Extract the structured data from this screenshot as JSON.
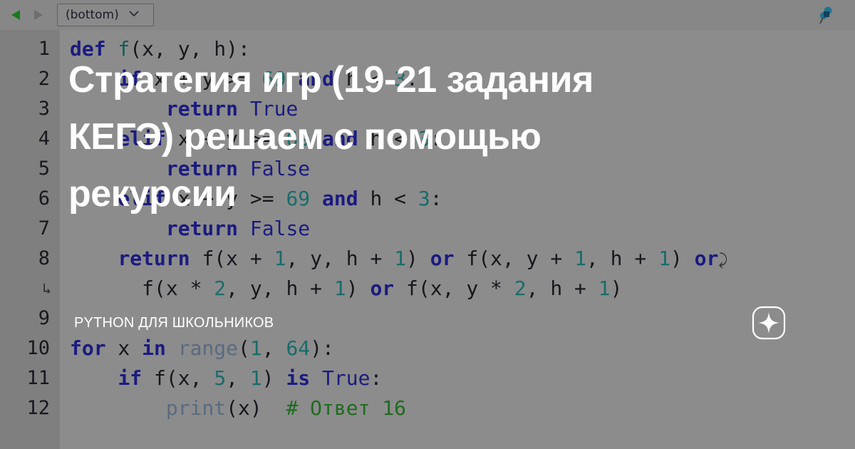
{
  "toolbar": {
    "back_icon": "triangle-left-icon",
    "forward_icon": "triangle-right-icon",
    "bookmark_value": "(bottom)",
    "chevron_icon": "chevron-down-icon",
    "pin_icon": "pushpin-icon"
  },
  "editor": {
    "line_numbers": [
      "1",
      "2",
      "3",
      "4",
      "5",
      "6",
      "7",
      "8",
      "",
      "9",
      "10",
      "11",
      "12"
    ],
    "wrap_marker": "↳",
    "lines": [
      {
        "n": "1",
        "tokens": [
          {
            "t": "def ",
            "c": "kw"
          },
          {
            "t": "f",
            "c": "fn"
          },
          {
            "t": "(x, y, h):",
            "c": "pn"
          }
        ]
      },
      {
        "n": "2",
        "tokens": [
          {
            "t": "    ",
            "c": "pn"
          },
          {
            "t": "if",
            "c": "kw"
          },
          {
            "t": " x + y >= ",
            "c": "pn"
          },
          {
            "t": "69",
            "c": "num"
          },
          {
            "t": " ",
            "c": "pn"
          },
          {
            "t": "and",
            "c": "kw"
          },
          {
            "t": " h < ",
            "c": "pn"
          },
          {
            "t": "3",
            "c": "num"
          },
          {
            "t": ":",
            "c": "pn"
          }
        ]
      },
      {
        "n": "3",
        "tokens": [
          {
            "t": "        ",
            "c": "pn"
          },
          {
            "t": "return",
            "c": "kw"
          },
          {
            "t": " ",
            "c": "pn"
          },
          {
            "t": "True",
            "c": "kw2"
          }
        ]
      },
      {
        "n": "4",
        "tokens": [
          {
            "t": "    ",
            "c": "pn"
          },
          {
            "t": "elif",
            "c": "kw"
          },
          {
            "t": " x + y >= ",
            "c": "pn"
          },
          {
            "t": "69",
            "c": "num"
          },
          {
            "t": " ",
            "c": "pn"
          },
          {
            "t": "and",
            "c": "kw"
          },
          {
            "t": " h < ",
            "c": "pn"
          },
          {
            "t": "3",
            "c": "num"
          },
          {
            "t": ":",
            "c": "pn"
          }
        ]
      },
      {
        "n": "5",
        "tokens": [
          {
            "t": "        ",
            "c": "pn"
          },
          {
            "t": "return",
            "c": "kw"
          },
          {
            "t": " ",
            "c": "pn"
          },
          {
            "t": "False",
            "c": "kw2"
          }
        ]
      },
      {
        "n": "6",
        "tokens": [
          {
            "t": "    ",
            "c": "pn"
          },
          {
            "t": "elif",
            "c": "kw"
          },
          {
            "t": " x + y >= ",
            "c": "pn"
          },
          {
            "t": "69",
            "c": "num"
          },
          {
            "t": " ",
            "c": "pn"
          },
          {
            "t": "and",
            "c": "kw"
          },
          {
            "t": " h < ",
            "c": "pn"
          },
          {
            "t": "3",
            "c": "num"
          },
          {
            "t": ":",
            "c": "pn"
          }
        ]
      },
      {
        "n": "7",
        "tokens": [
          {
            "t": "        ",
            "c": "pn"
          },
          {
            "t": "return",
            "c": "kw"
          },
          {
            "t": " ",
            "c": "pn"
          },
          {
            "t": "False",
            "c": "kw2"
          }
        ]
      },
      {
        "n": "8",
        "tokens": [
          {
            "t": "    ",
            "c": "pn"
          },
          {
            "t": "return",
            "c": "kw"
          },
          {
            "t": " f(x + ",
            "c": "pn"
          },
          {
            "t": "1",
            "c": "num"
          },
          {
            "t": ", y, h + ",
            "c": "pn"
          },
          {
            "t": "1",
            "c": "num"
          },
          {
            "t": ") ",
            "c": "pn"
          },
          {
            "t": "or",
            "c": "kw"
          },
          {
            "t": " f(x, y + ",
            "c": "pn"
          },
          {
            "t": "1",
            "c": "num"
          },
          {
            "t": ", h + ",
            "c": "pn"
          },
          {
            "t": "1",
            "c": "num"
          },
          {
            "t": ") ",
            "c": "pn"
          },
          {
            "t": "or",
            "c": "kw"
          }
        ]
      },
      {
        "n": "",
        "wrapped": true,
        "tokens": [
          {
            "t": "      f(x * ",
            "c": "pn"
          },
          {
            "t": "2",
            "c": "num"
          },
          {
            "t": ", y, h + ",
            "c": "pn"
          },
          {
            "t": "1",
            "c": "num"
          },
          {
            "t": ") ",
            "c": "pn"
          },
          {
            "t": "or",
            "c": "kw"
          },
          {
            "t": " f(x, y * ",
            "c": "pn"
          },
          {
            "t": "2",
            "c": "num"
          },
          {
            "t": ", h + ",
            "c": "pn"
          },
          {
            "t": "1",
            "c": "num"
          },
          {
            "t": ")",
            "c": "pn"
          }
        ]
      },
      {
        "n": "9",
        "tokens": [
          {
            "t": "",
            "c": "pn"
          }
        ]
      },
      {
        "n": "10",
        "tokens": [
          {
            "t": "for",
            "c": "kw"
          },
          {
            "t": " x ",
            "c": "pn"
          },
          {
            "t": "in",
            "c": "kw"
          },
          {
            "t": " ",
            "c": "pn"
          },
          {
            "t": "range",
            "c": "bi"
          },
          {
            "t": "(",
            "c": "pn"
          },
          {
            "t": "1",
            "c": "num"
          },
          {
            "t": ", ",
            "c": "pn"
          },
          {
            "t": "64",
            "c": "num"
          },
          {
            "t": "):",
            "c": "pn"
          }
        ]
      },
      {
        "n": "11",
        "tokens": [
          {
            "t": "    ",
            "c": "pn"
          },
          {
            "t": "if",
            "c": "kw"
          },
          {
            "t": " f(x, ",
            "c": "pn"
          },
          {
            "t": "5",
            "c": "num"
          },
          {
            "t": ", ",
            "c": "pn"
          },
          {
            "t": "1",
            "c": "num"
          },
          {
            "t": ") ",
            "c": "pn"
          },
          {
            "t": "is",
            "c": "kw"
          },
          {
            "t": " ",
            "c": "pn"
          },
          {
            "t": "True",
            "c": "kw2"
          },
          {
            "t": ":",
            "c": "pn"
          }
        ]
      },
      {
        "n": "12",
        "tokens": [
          {
            "t": "        ",
            "c": "pn"
          },
          {
            "t": "print",
            "c": "bi"
          },
          {
            "t": "(x)  ",
            "c": "pn"
          },
          {
            "t": "# Ответ 16",
            "c": "cmt"
          }
        ]
      }
    ]
  },
  "overlay": {
    "title_lines": [
      "Стратегия игр (19-21 задания",
      "КЕГЭ) решаем с помощью",
      "рекурсии"
    ],
    "brand": "PYTHON ДЛЯ ШКОЛЬНИКОВ",
    "ai_badge_icon": "sparkle-icon"
  },
  "colors": {
    "toolbar_bg": "#878787",
    "gutter_bg": "#7f7f7f",
    "code_bg": "#8c8c8c",
    "keyword": "#1b1b80",
    "number": "#1a6b6b",
    "function": "#0e5c5c",
    "builtin": "#5a6a80",
    "comment": "#1f6b1f",
    "overlay_text": "#ffffff",
    "back_arrow": "#1a7a1a",
    "forward_arrow": "#6e6e6e",
    "pin": "#1d6f8e"
  }
}
